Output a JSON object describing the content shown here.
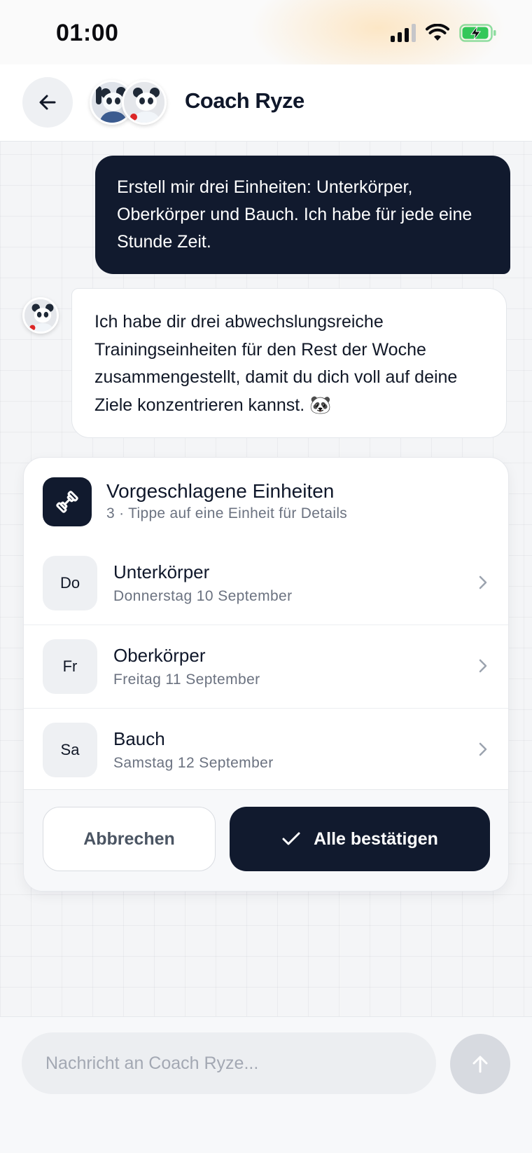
{
  "status_bar": {
    "time": "01:00"
  },
  "header": {
    "title": "Coach Ryze",
    "back_icon": "arrow-left-icon"
  },
  "messages": [
    {
      "role": "user",
      "text": "Erstell mir drei Einheiten: Unterkörper, Oberkörper und Bauch. Ich habe für jede eine Stunde Zeit."
    },
    {
      "role": "coach",
      "text": "Ich habe dir drei abwechslungsreiche Trainingseinheiten für den Rest der Woche zusammengestellt, damit du dich voll auf deine Ziele konzentrieren kannst. 🐼"
    }
  ],
  "suggestions": {
    "icon": "dumbbell-icon",
    "title": "Vorgeschlagene Einheiten",
    "subtitle": "3 · Tippe auf eine Einheit für Details",
    "sessions": [
      {
        "day": "Do",
        "name": "Unterkörper",
        "date": "Donnerstag 10 September"
      },
      {
        "day": "Fr",
        "name": "Oberkörper",
        "date": "Freitag 11 September"
      },
      {
        "day": "Sa",
        "name": "Bauch",
        "date": "Samstag 12 September"
      }
    ],
    "cancel_label": "Abbrechen",
    "confirm_label": "Alle bestätigen"
  },
  "composer": {
    "placeholder": "Nachricht an Coach Ryze...",
    "send_icon": "arrow-up-icon"
  },
  "colors": {
    "primary_dark": "#111a2e",
    "muted_text": "#6b7280",
    "battery_green": "#34c759"
  }
}
